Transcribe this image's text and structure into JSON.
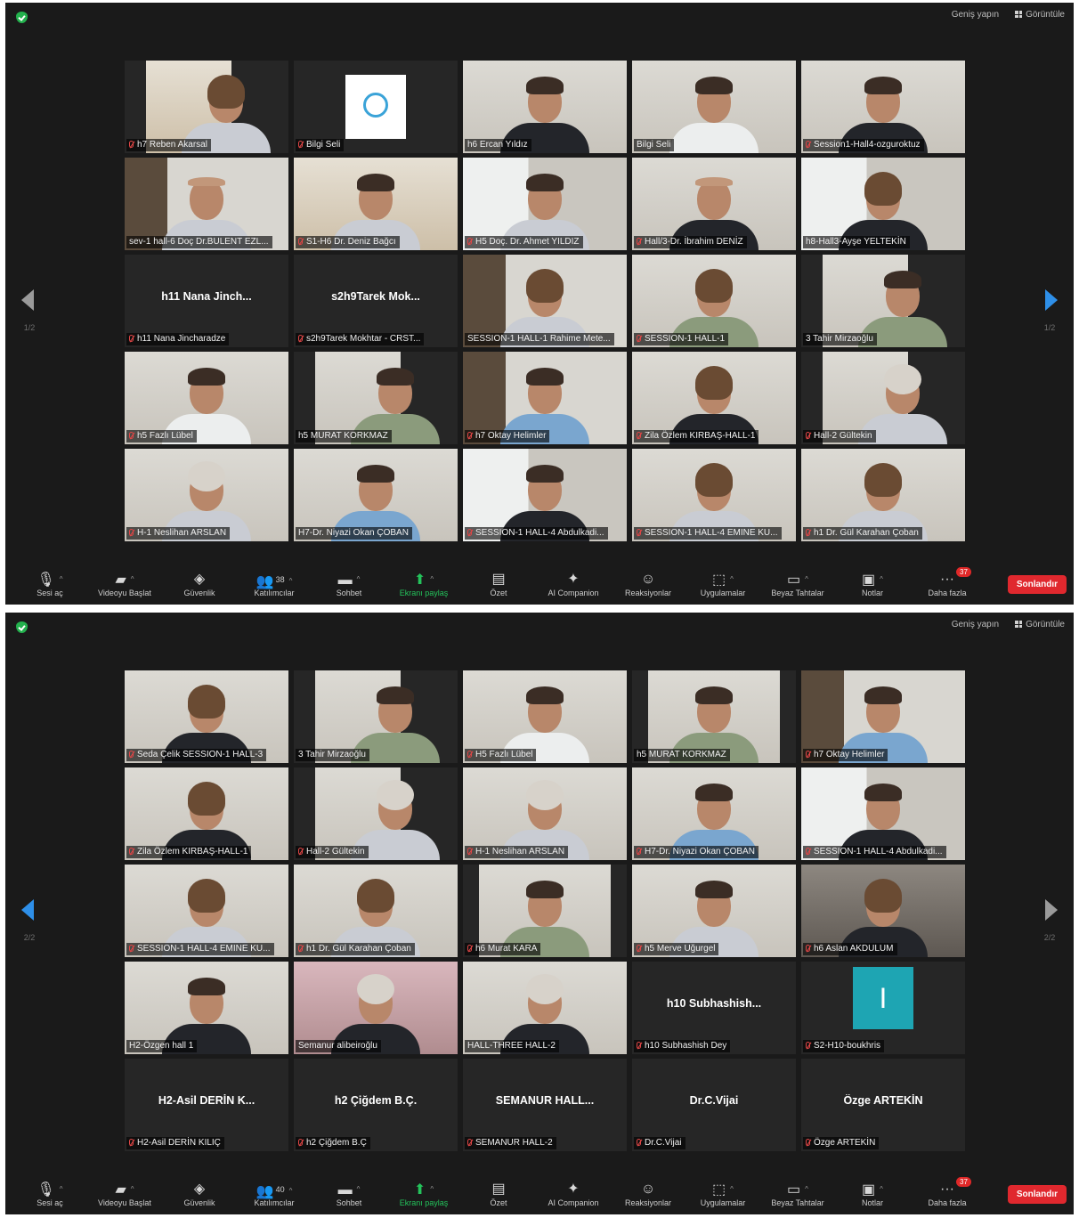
{
  "header": {
    "full_screen": "Geniş yapın",
    "view": "Görüntüle"
  },
  "toolbar": {
    "items": [
      {
        "key": "mic",
        "label": "Sesi aç",
        "icon": "muted-mic-icon",
        "caret": true
      },
      {
        "key": "video",
        "label": "Videoyu Başlat",
        "icon": "video-off-icon",
        "caret": true
      },
      {
        "key": "security",
        "label": "Güvenlik",
        "icon": "shield-icon"
      },
      {
        "key": "participants",
        "label": "Katılımcılar",
        "icon": "participants-icon",
        "caret": true
      },
      {
        "key": "chat",
        "label": "Sohbet",
        "icon": "chat-icon",
        "caret": true
      },
      {
        "key": "share",
        "label": "Ekranı paylaş",
        "icon": "share-screen-icon",
        "caret": true,
        "highlight": "#24c35b"
      },
      {
        "key": "summary",
        "label": "Özet",
        "icon": "summary-icon"
      },
      {
        "key": "ai",
        "label": "AI Companion",
        "icon": "sparkle-icon"
      },
      {
        "key": "reactions",
        "label": "Reaksiyonlar",
        "icon": "reaction-icon"
      },
      {
        "key": "apps",
        "label": "Uygulamalar",
        "icon": "apps-icon",
        "caret": true
      },
      {
        "key": "whiteboards",
        "label": "Beyaz Tahtalar",
        "icon": "whiteboard-icon",
        "caret": true
      },
      {
        "key": "notes",
        "label": "Notlar",
        "icon": "notes-icon",
        "caret": true
      },
      {
        "key": "more",
        "label": "Daha fazla",
        "icon": "more-icon"
      }
    ],
    "end_label": "Sonlandır",
    "end_color": "#e0282e"
  },
  "screens": [
    {
      "participants_count": "38",
      "more_badge": "37",
      "page_left": "1/2",
      "page_right": "1/2",
      "active_nav": "right",
      "tiles": [
        {
          "label": "h7 Reben Akarsal",
          "muted": true,
          "scene": "n2 warm",
          "person": "f lt"
        },
        {
          "label": "Bilgi Seli",
          "muted": true,
          "scene": "logo"
        },
        {
          "label": "h6 Ercan Yıldız",
          "muted": false,
          "scene": "",
          "person": "dk"
        },
        {
          "label": "Bilgi Seli",
          "muted": false,
          "scene": "",
          "person": "wh",
          "active": true
        },
        {
          "label": "Session1-Hall4-ozguroktuz",
          "muted": true,
          "scene": "",
          "person": "dk"
        },
        {
          "label": "sev-1 hall-6 Doç Dr.BULENT EZL...",
          "muted": false,
          "scene": "shelf",
          "person": "bald lt"
        },
        {
          "label": "S1-H6 Dr. Deniz Bağcı",
          "muted": true,
          "scene": "warm",
          "person": "lt"
        },
        {
          "label": "H5 Doç. Dr. Ahmet YILDIZ",
          "muted": true,
          "scene": "window",
          "person": "lt"
        },
        {
          "label": "Hall/3-Dr. İbrahim DENİZ",
          "muted": true,
          "scene": "",
          "person": "bald dk"
        },
        {
          "label": "h8-Hall3-Ayşe YELTEKİN",
          "muted": false,
          "scene": "window",
          "person": "f dk"
        },
        {
          "label": "h11 Nana Jincharadze",
          "muted": true,
          "name": "h11 Nana Jinch..."
        },
        {
          "label": "s2h9Tarek Mokhtar - CRST...",
          "muted": true,
          "name": "s2h9Tarek Mok..."
        },
        {
          "label": "SESSION-1 HALL-1 Rahime Mete...",
          "muted": false,
          "scene": "shelf",
          "person": "f lt"
        },
        {
          "label": "SESSION-1 HALL-1",
          "muted": true,
          "scene": "",
          "person": "f gr"
        },
        {
          "label": "3 Tahir Mirzaoğlu",
          "muted": false,
          "scene": "n2",
          "person": "gr"
        },
        {
          "label": "h5 Fazlı Lübel",
          "muted": true,
          "scene": "",
          "person": "wh"
        },
        {
          "label": "h5 MURAT KORKMAZ",
          "muted": false,
          "scene": "n2",
          "person": "gr"
        },
        {
          "label": "h7 Oktay Helimler",
          "muted": true,
          "scene": "shelf",
          "person": "bl"
        },
        {
          "label": "Zila Özlem KIRBAŞ-HALL-1",
          "muted": true,
          "scene": "",
          "person": "f dk"
        },
        {
          "label": "Hall-2 Gültekin",
          "muted": true,
          "scene": "n2",
          "person": "sc lt"
        },
        {
          "label": "H-1 Neslihan ARSLAN",
          "muted": true,
          "scene": "",
          "person": "sc lt"
        },
        {
          "label": "H7-Dr. Niyazi Okan ÇOBAN",
          "muted": false,
          "scene": "",
          "person": "bl"
        },
        {
          "label": "SESSION-1 HALL-4 Abdulkadi...",
          "muted": true,
          "scene": "window",
          "person": "dk"
        },
        {
          "label": "SESSION-1 HALL-4 EMINE KU...",
          "muted": true,
          "scene": "",
          "person": "f lt"
        },
        {
          "label": "h1 Dr. Gül Karahan Çoban",
          "muted": true,
          "scene": "",
          "person": "f lt"
        }
      ]
    },
    {
      "participants_count": "40",
      "more_badge": "37",
      "page_left": "2/2",
      "page_right": "2/2",
      "active_nav": "left",
      "tiles": [
        {
          "label": "Seda Çelik SESSION-1 HALL-3",
          "muted": true,
          "scene": "",
          "person": "f dk"
        },
        {
          "label": "3 Tahir Mirzaoğlu",
          "muted": false,
          "scene": "n2",
          "person": "gr"
        },
        {
          "label": "H5 Fazlı Lübel",
          "muted": true,
          "scene": "",
          "person": "wh"
        },
        {
          "label": "h5 MURAT KORKMAZ",
          "muted": false,
          "scene": "n",
          "person": "gr"
        },
        {
          "label": "h7 Oktay Helimler",
          "muted": true,
          "scene": "shelf",
          "person": "bl"
        },
        {
          "label": "Zila Özlem KIRBAŞ-HALL-1",
          "muted": true,
          "scene": "",
          "person": "f dk"
        },
        {
          "label": "Hall-2 Gültekin",
          "muted": true,
          "scene": "n2",
          "person": "sc lt"
        },
        {
          "label": "H-1 Neslihan ARSLAN",
          "muted": true,
          "scene": "",
          "person": "sc lt"
        },
        {
          "label": "H7-Dr. Niyazi Okan ÇOBAN",
          "muted": true,
          "scene": "",
          "person": "bl"
        },
        {
          "label": "SESSION-1 HALL-4 Abdulkadi...",
          "muted": true,
          "scene": "window",
          "person": "dk"
        },
        {
          "label": "SESSION-1 HALL-4 EMINE KU...",
          "muted": true,
          "scene": "",
          "person": "f lt"
        },
        {
          "label": "h1 Dr. Gül Karahan Çoban",
          "muted": true,
          "scene": "",
          "person": "f lt"
        },
        {
          "label": "h6 Murat KARA",
          "muted": true,
          "scene": "n",
          "person": "gr"
        },
        {
          "label": "h5 Merve Uğurgel",
          "muted": true,
          "scene": "",
          "person": "lt"
        },
        {
          "label": "h6 Aslan AKDULUM",
          "muted": true,
          "scene": "dark",
          "person": "f dk"
        },
        {
          "label": "H2-Özgen hall 1",
          "muted": false,
          "scene": "",
          "person": "dk"
        },
        {
          "label": "Semanur alibeiroğlu",
          "muted": false,
          "scene": "pink",
          "person": "sc dk"
        },
        {
          "label": "HALL-THREE HALL-2",
          "muted": false,
          "scene": "",
          "person": "sc dk"
        },
        {
          "label": "h10 Subhashish Dey",
          "muted": true,
          "name": "h10 Subhashish..."
        },
        {
          "label": "S2-H10-boukhris",
          "muted": true,
          "letter": "I"
        },
        {
          "label": "H2-Asil DERİN KILIÇ",
          "muted": true,
          "name": "H2-Asil DERİN K..."
        },
        {
          "label": "h2 Çiğdem B.Ç",
          "muted": true,
          "name": "h2 Çiğdem B.Ç."
        },
        {
          "label": "SEMANUR HALL-2",
          "muted": true,
          "name": "SEMANUR HALL..."
        },
        {
          "label": "Dr.C.Vijai",
          "muted": true,
          "name": "Dr.C.Vijai"
        },
        {
          "label": "Özge ARTEKİN",
          "muted": true,
          "name": "Özge ARTEKİN"
        }
      ]
    }
  ]
}
